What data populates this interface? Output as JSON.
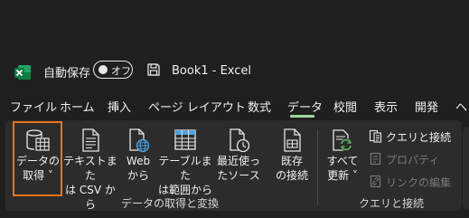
{
  "title_bar": {
    "autosave_label": "自動保存",
    "autosave_state": "オフ",
    "document_title": "Book1  -  Excel"
  },
  "tabs": [
    {
      "label": "ファイル"
    },
    {
      "label": "ホーム"
    },
    {
      "label": "挿入"
    },
    {
      "label": "ページ レイアウト"
    },
    {
      "label": "数式"
    },
    {
      "label": "データ"
    },
    {
      "label": "校閲"
    },
    {
      "label": "表示"
    },
    {
      "label": "開発"
    },
    {
      "label": "ヘ"
    }
  ],
  "active_tab": "データ",
  "ribbon": {
    "get_transform": {
      "group_label": "データの取得と変換",
      "get_data_label": "データの\n取得 ˅",
      "from_text_csv_label": "テキストまた\nは CSV から",
      "from_web_label": "Web\nから",
      "from_table_label": "テーブルまた\nは範囲から",
      "recent_sources_label": "最近使っ\nたソース",
      "existing_connections_label": "既存\nの接続"
    },
    "queries": {
      "group_label": "クエリと接続",
      "refresh_all_label": "すべて\n更新 ˅",
      "queries_connections_label": "クエリと接続",
      "properties_label": "プロパティ",
      "edit_links_label": "リンクの編集"
    }
  },
  "colors": {
    "background": "#1f1f1f",
    "ribbon": "#2c2c2c",
    "active_tab_underline": "#9ed59e",
    "highlight_box": "#e8751a",
    "excel_green": "#107c41"
  }
}
